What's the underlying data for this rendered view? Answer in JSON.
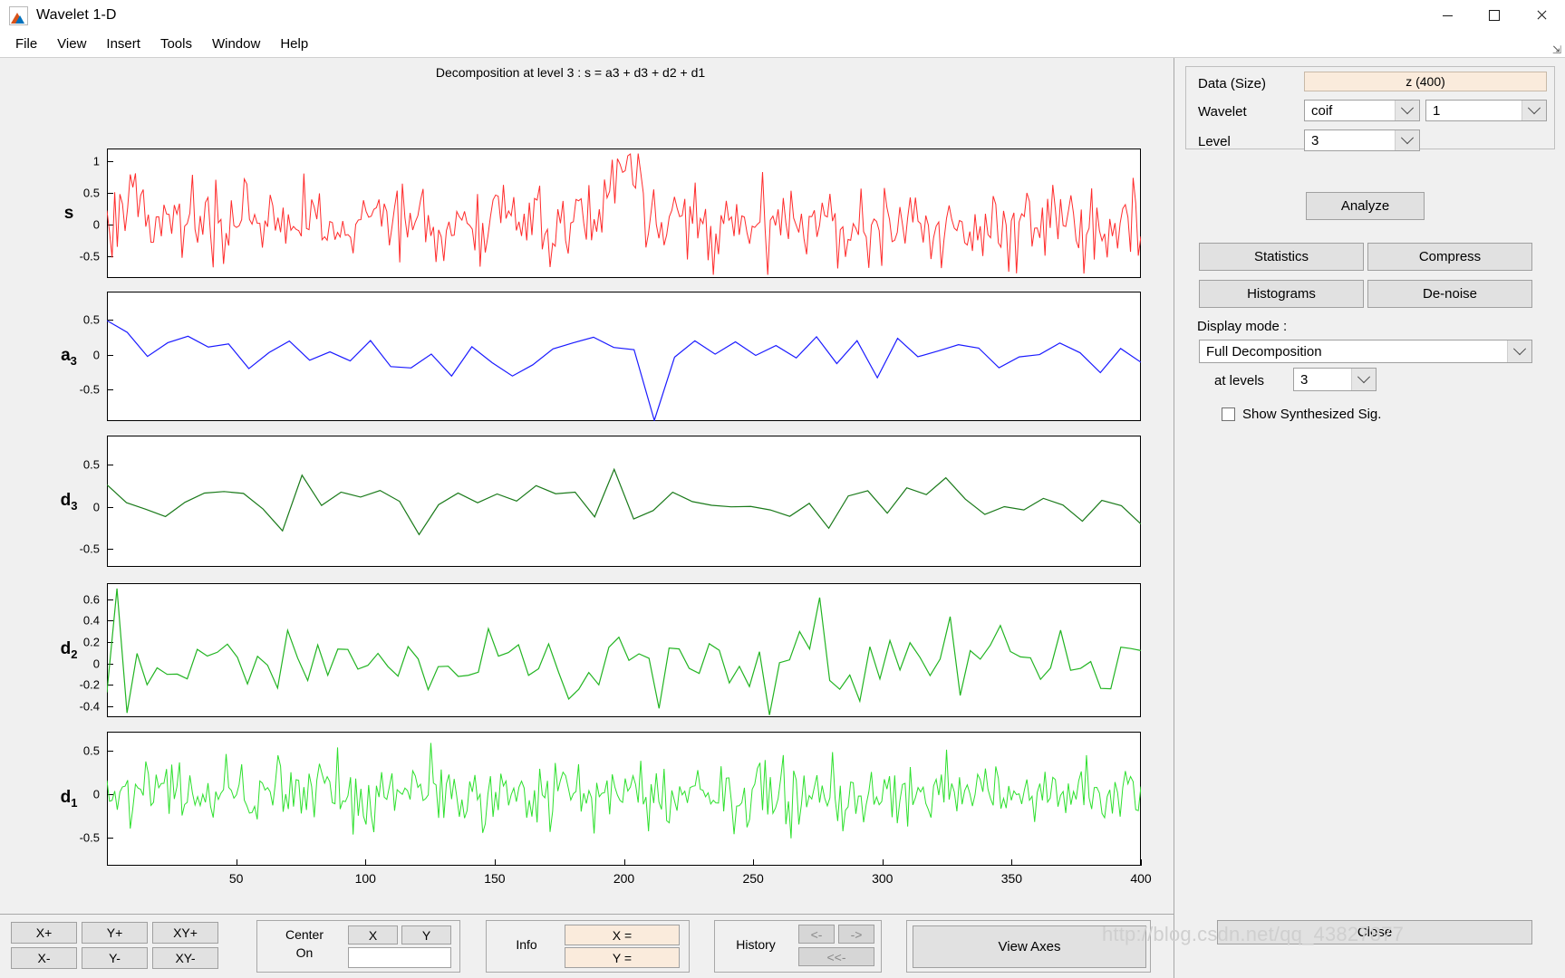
{
  "window": {
    "title": "Wavelet 1-D",
    "icon": "wavelet-app-icon",
    "minimize": "─",
    "maximize": "□",
    "close": "✕"
  },
  "menubar": {
    "items": [
      "File",
      "View",
      "Insert",
      "Tools",
      "Window",
      "Help"
    ]
  },
  "plot": {
    "title": "Decomposition at level 3 : s = a3 + d3 + d2 + d1",
    "xticks": [
      "50",
      "100",
      "150",
      "200",
      "250",
      "300",
      "350",
      "400"
    ]
  },
  "chart_data": {
    "type": "line",
    "title": "Decomposition at level 3 : s = a3 + d3 + d2 + d1",
    "xlabel": "",
    "ylabel": "",
    "xlim": [
      1,
      400
    ],
    "grid": false,
    "legend": "none",
    "panels": [
      {
        "name": "s",
        "label": "s",
        "color": "#ff2b2b",
        "yticks": [
          1,
          0.5,
          0,
          -0.5
        ],
        "ylim": [
          -0.85,
          1.2
        ],
        "n": 400,
        "seed": 17,
        "kind": "signal",
        "description": "Original noisy signal with burst near x=200"
      },
      {
        "name": "a3",
        "label": "a₃",
        "color": "#1a1aff",
        "yticks": [
          0.5,
          0,
          -0.5
        ],
        "ylim": [
          -0.95,
          0.9
        ],
        "n": 52,
        "seed": 41,
        "kind": "approx",
        "description": "Level-3 approximation coefficients, strong spike near x=200"
      },
      {
        "name": "d3",
        "label": "d₃",
        "color": "#1a7a1a",
        "yticks": [
          0.5,
          0,
          -0.5
        ],
        "ylim": [
          -0.72,
          0.85
        ],
        "n": 54,
        "seed": 63,
        "kind": "detail3",
        "description": "Level-3 detail coefficients with large oscillation near x=200"
      },
      {
        "name": "d2",
        "label": "d₂",
        "color": "#22b422",
        "yticks": [
          0.6,
          0.4,
          0.2,
          0,
          -0.2,
          -0.4
        ],
        "ylim": [
          -0.5,
          0.75
        ],
        "n": 104,
        "seed": 91,
        "kind": "detail2",
        "description": "Level-2 detail coefficients"
      },
      {
        "name": "d1",
        "label": "d₁",
        "color": "#2ee02e",
        "yticks": [
          0.5,
          0,
          -0.5
        ],
        "ylim": [
          -0.82,
          0.72
        ],
        "n": 400,
        "seed": 131,
        "kind": "detail1",
        "description": "Level-1 detail coefficients, dense high-frequency noise"
      }
    ]
  },
  "toolbar": {
    "zoom_buttons": [
      "X+",
      "Y+",
      "XY+",
      "X-",
      "Y-",
      "XY-"
    ],
    "center_on_label": "Center\nOn",
    "center_on_line1": "Center",
    "center_on_line2": "On",
    "center_x": "X",
    "center_y": "Y",
    "center_value": "",
    "info_label": "Info",
    "info_x": "X =",
    "info_y": "Y =",
    "history_label": "History",
    "history_back": "<-",
    "history_forward": "->",
    "history_reset": "<<-",
    "view_axes": "View Axes"
  },
  "rightpanel": {
    "data_label": "Data  (Size)",
    "data_value": "z  (400)",
    "wavelet_label": "Wavelet",
    "wavelet_family": "coif",
    "wavelet_number": "1",
    "level_label": "Level",
    "level_value": "3",
    "analyze": "Analyze",
    "statistics": "Statistics",
    "compress": "Compress",
    "histograms": "Histograms",
    "denoise": "De-noise",
    "display_mode_label": "Display mode :",
    "display_mode_value": "Full Decomposition",
    "at_levels_label": "at levels",
    "at_levels_value": "3",
    "show_synth_label": "Show Synthesized Sig.",
    "close": "Close"
  },
  "watermark": {
    "text": "http://blog.csdn.net/qq_43827877"
  }
}
